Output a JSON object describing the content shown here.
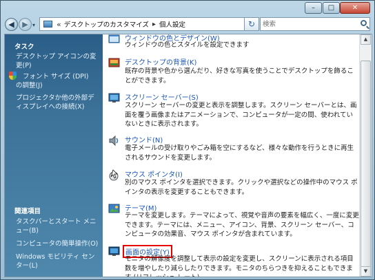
{
  "nav": {
    "back_icon": "back-arrow-icon",
    "forward_icon": "forward-arrow-icon",
    "recent_glyph": "▾"
  },
  "address": {
    "raquo": "«",
    "crumbs": [
      "デスクトップのカスタマイズ",
      "個人設定"
    ],
    "separator": "▸",
    "dropdown": "▾"
  },
  "refresh_glyph": "↻",
  "search": {
    "placeholder": "検索"
  },
  "window_controls": {
    "minimize": "–",
    "maximize": "□",
    "close": "✕"
  },
  "sidebar": {
    "tasks_heading": "タスク",
    "tasks": [
      "デスクトップ アイコンの変更(P)",
      "フォント サイズ (DPI) の調整(J)",
      "プロジェクタか他の外部ディスプレイへの接続(X)"
    ],
    "related_heading": "関連項目",
    "related": [
      "タスクバーとスタート メニュー(B)",
      "コンピュータの簡単操作(O)",
      "Windows モビリティ センター(L)"
    ]
  },
  "items": [
    {
      "title": "ウィンドウの色とデザイン(W)",
      "desc": "ウィンドウの色とスタイルを設定できます",
      "icon": "window-color-icon"
    },
    {
      "title": "デスクトップの背景(K)",
      "desc": "既存の背景や色から選んだり、好きな写真を使うことでデスクトップを飾ることができます。",
      "icon": "desktop-background-icon"
    },
    {
      "title": "スクリーン セーバー(S)",
      "desc": "スクリーン セーバーの変更と表示を調整します。スクリーン セーバーとは、画面を覆う画像またはアニメーションで、コンピュータが一定の間、使われていないときに表示されます。",
      "icon": "screensaver-icon"
    },
    {
      "title": "サウンド(N)",
      "desc": "電子メールの受け取りやごみ箱を空にするなど、様々な動作を行うときに再生されるサウンドを変更します。",
      "icon": "sound-icon"
    },
    {
      "title": "マウス ポインタ(I)",
      "desc": "別のマウス ポインタを選択できます。クリックや選択などの操作中のマウス ポインタの表示を変更することもできます。",
      "icon": "mouse-pointer-icon"
    },
    {
      "title": "テーマ(M)",
      "desc": "テーマを変更します。テーマによって、視覚や音声の要素を幅広く、一度に変更できます。テーマには、メニュー、アイコン、背景、スクリーン セーバー、コンピュータの効果音、マウス ポインタが含まれています。",
      "icon": "theme-icon"
    },
    {
      "title": "画面の設定(Y)",
      "desc": "モニタの解像度を調整して表示の設定を変更し、スクリーンに表示される項目数を増やしたり減らしたりできます。モニタのちらつきを抑えることもできます (リフレッシュ レート)。",
      "icon": "display-settings-icon"
    }
  ],
  "scrollbar": {
    "up": "▲",
    "down": "▼"
  }
}
